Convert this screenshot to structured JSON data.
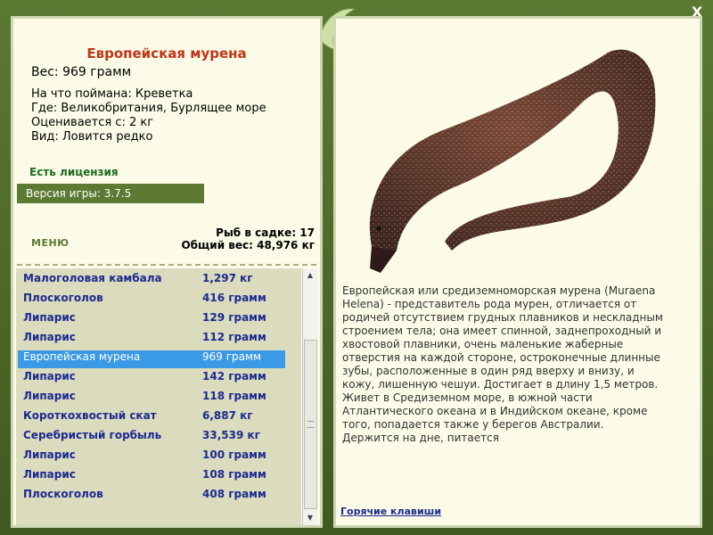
{
  "window": {
    "close_label": "X"
  },
  "fish": {
    "title": "Европейская мурена",
    "weight": "Вес: 969 грамм",
    "bait": "На что поймана: Креветка",
    "location": "Где: Великобритания, Бурлящее море",
    "value": "Оценивается с: 2 кг",
    "rarity": "Вид: Ловится редко",
    "description": "Европейская или средиземноморская мурена (Muraena Helena) - представитель рода мурен, отличается от родичей отсутствием грудных плавников и нескладным строением тела; она имеет спинной, заднепроходный и хвостовой плавники, очень маленькие жаберные отверстия на каждой стороне, остроконечные длинные зубы, расположенные в один ряд вверху и внизу, и кожу, лишенную чешуи. Достигает в длину 1,5 метров. Живет в Средиземном море, в южной части Атлантического океана и в Индийском океане, кроме того, попадается также у берегов Австралии. Держится на дне, питается"
  },
  "license": "Есть лицензия",
  "version": "Версия игры: 3.7.5",
  "menu_label": "МЕНЮ",
  "stats": {
    "count": "Рыб в садке: 17",
    "total": "Общий вес: 48,976 кг"
  },
  "catch_list": [
    {
      "name": "Малоголовая камбала",
      "weight": "1,297 кг"
    },
    {
      "name": "Плоскоголов",
      "weight": "416 грамм"
    },
    {
      "name": "Липарис",
      "weight": "129 грамм"
    },
    {
      "name": "Липарис",
      "weight": "112 грамм"
    },
    {
      "name": "Европейская мурена",
      "weight": "969 грамм"
    },
    {
      "name": "Липарис",
      "weight": "142 грамм"
    },
    {
      "name": "Липарис",
      "weight": "118 грамм"
    },
    {
      "name": "Короткохвостый скат",
      "weight": "6,887 кг"
    },
    {
      "name": "Серебристый горбыль",
      "weight": "33,539 кг"
    },
    {
      "name": "Липарис",
      "weight": "100 грамм"
    },
    {
      "name": "Липарис",
      "weight": "108 грамм"
    },
    {
      "name": "Плоскоголов",
      "weight": "408 грамм"
    }
  ],
  "hotkeys_label": "Горячие клавиши",
  "colors": {
    "accent_red": "#c03418",
    "list_text": "#1c2a8f",
    "selection": "#3b9ae6",
    "frame_green": "#5d7a33"
  }
}
